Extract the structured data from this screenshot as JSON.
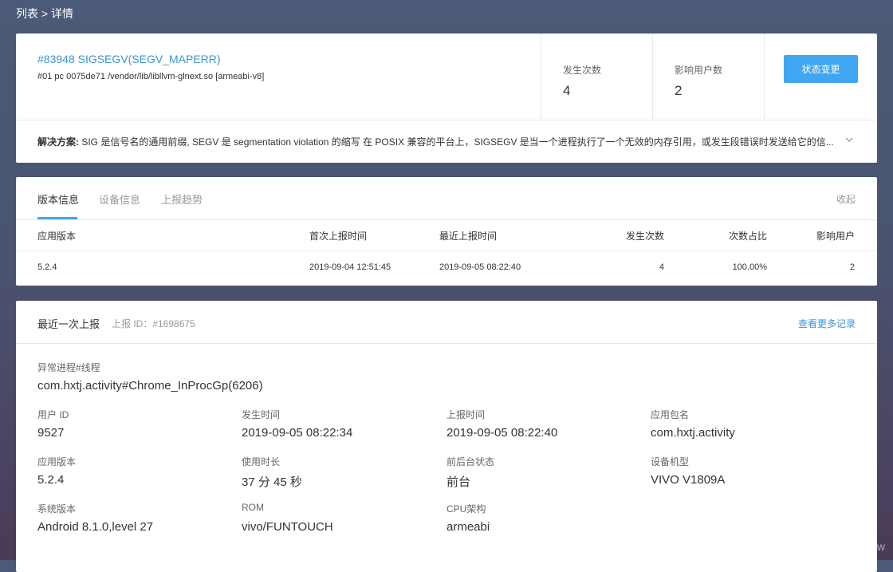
{
  "breadcrumb": "列表 > 详情",
  "crash": {
    "title": "#83948 SIGSEGV(SEGV_MAPERR)",
    "frame": "#01 pc 0075de71 /vendor/lib/libllvm-glnext.so [armeabi-v8]",
    "stats": [
      {
        "label": "发生次数",
        "value": "4"
      },
      {
        "label": "影响用户数",
        "value": "2"
      }
    ],
    "status_button": "状态变更",
    "solution_label": "解决方案:",
    "solution_text": " SIG 是信号名的通用前缀, SEGV 是 segmentation violation 的缩写 在 POSIX 兼容的平台上，SIGSEGV 是当一个进程执行了一个无效的内存引用，或发生段错误时发送给它的信..."
  },
  "version": {
    "tabs": [
      "版本信息",
      "设备信息",
      "上报趋势"
    ],
    "collapse": "收起",
    "columns": [
      "应用版本",
      "首次上报时间",
      "最近上报时间",
      "发生次数",
      "次数占比",
      "影响用户"
    ],
    "rows": [
      [
        "5.2.4",
        "2019-09-04 12:51:45",
        "2019-09-05 08:22:40",
        "4",
        "100.00%",
        "2"
      ]
    ]
  },
  "report": {
    "title": "最近一次上报",
    "report_id": "上报 ID：#1698675",
    "more_link": "查看更多记录",
    "process": {
      "label": "异常进程#线程",
      "value": "com.hxtj.activity#Chrome_InProcGp(6206)"
    },
    "fields": [
      {
        "label": "用户 ID",
        "value": "9527"
      },
      {
        "label": "发生时间",
        "value": "2019-09-05 08:22:34"
      },
      {
        "label": "上报时间",
        "value": "2019-09-05 08:22:40"
      },
      {
        "label": "应用包名",
        "value": "com.hxtj.activity"
      },
      {
        "label": "应用版本",
        "value": "5.2.4"
      },
      {
        "label": "使用时长",
        "value": "37 分 45 秒"
      },
      {
        "label": "前后台状态",
        "value": "前台"
      },
      {
        "label": "设备机型",
        "value": "VIVO V1809A"
      },
      {
        "label": "系统版本",
        "value": "Android 8.1.0,level 27"
      },
      {
        "label": "ROM",
        "value": "vivo/FUNTOUCH"
      },
      {
        "label": "CPU架构",
        "value": "armeabi"
      }
    ]
  },
  "watermark": "https://blog.csdn.net/android_gw",
  "colors": {
    "accent": "#41a6f2",
    "link": "#3b95d6"
  },
  "icons": {
    "solution_expand": "chevron-down-icon"
  }
}
